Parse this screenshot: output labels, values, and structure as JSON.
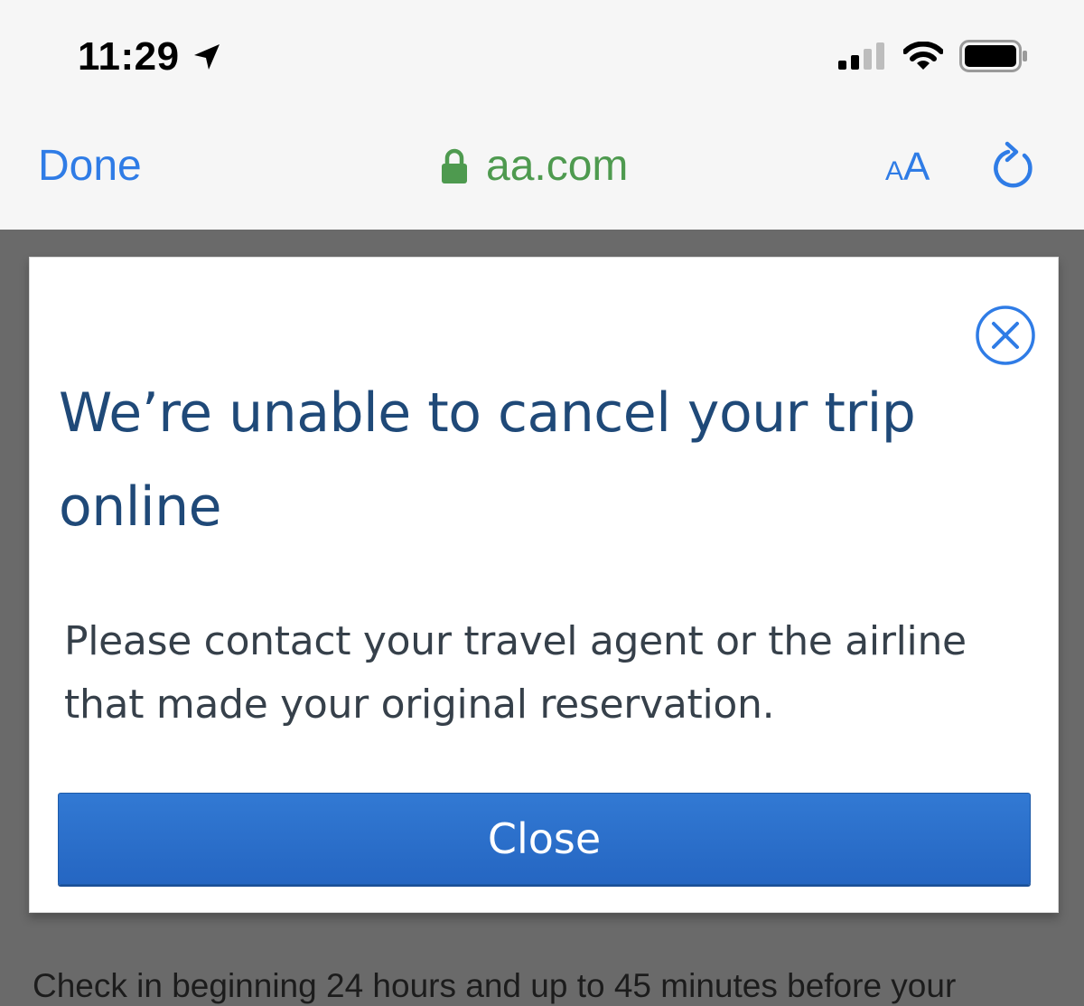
{
  "status_bar": {
    "time": "11:29",
    "icons": [
      "location-arrow-icon",
      "cellular-signal-icon",
      "wifi-icon",
      "battery-icon"
    ]
  },
  "browser": {
    "done_label": "Done",
    "url": "aa.com",
    "text_size_small": "A",
    "text_size_large": "A"
  },
  "modal": {
    "title": "We’re unable to cancel your trip online",
    "message": "Please contact your travel agent or the airline that made your original reservation.",
    "close_button_label": "Close"
  },
  "page": {
    "bottom_text": "Check in beginning 24 hours and up to 45 minutes before your"
  },
  "colors": {
    "ios_blue": "#2f7ce6",
    "secure_green": "#4e9a4f",
    "title_navy": "#1f4978",
    "button_blue": "#2a6fca",
    "backdrop": "#6a6a6a"
  }
}
